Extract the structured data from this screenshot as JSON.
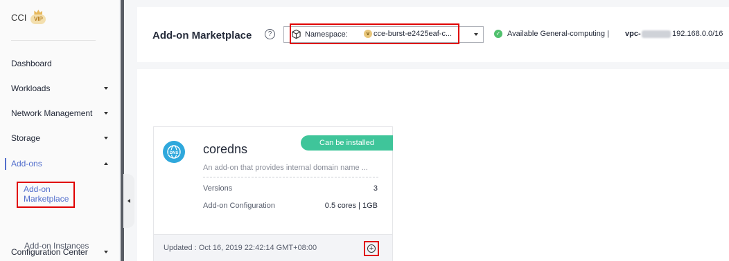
{
  "brand": {
    "text": "CCI",
    "vip_label": "VIP"
  },
  "sidebar": {
    "items": [
      {
        "label": "Dashboard"
      },
      {
        "label": "Workloads"
      },
      {
        "label": "Network Management"
      },
      {
        "label": "Storage"
      },
      {
        "label": "Add-ons"
      },
      {
        "label": "Configuration Center"
      }
    ],
    "sub_items": [
      {
        "label": "Add-on Marketplace"
      },
      {
        "label": "Add-on Instances"
      }
    ]
  },
  "header": {
    "title": "Add-on Marketplace",
    "help_glyph": "?",
    "namespace_label": "Namespace:",
    "namespace_badge": "v",
    "namespace_value": "cce-burst-e2425eaf-c...",
    "status_text": "Available   General-computing |",
    "vpc_label": "vpc-",
    "vpc_cidr": "192.168.0.0/16"
  },
  "card": {
    "name": "coredns",
    "logo_text": "DNS",
    "status": "Can be installed",
    "description": "An add-on that provides internal domain name ...",
    "rows": [
      {
        "label": "Versions",
        "value": "3"
      },
      {
        "label": "Add-on Configuration",
        "value": "0.5 cores | 1GB"
      }
    ],
    "updated": "Updated : Oct 16, 2019 22:42:14 GMT+08:00",
    "install_glyph": "+"
  },
  "colors": {
    "accent": "#526ecc",
    "highlight": "#e00000",
    "success": "#3fc59a"
  }
}
